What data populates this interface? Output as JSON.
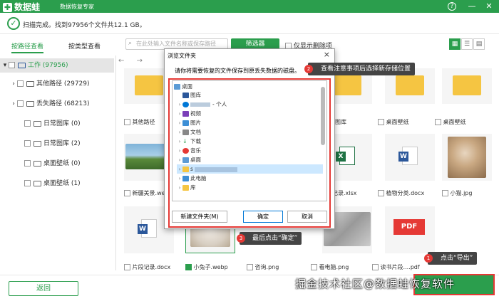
{
  "app": {
    "name": "数据蛙",
    "subtitle": "数据恢复专家",
    "status": "扫描完成。找到97956个文件共12.1 GB。"
  },
  "colors": {
    "brand": "#2b9e4d",
    "accent_red": "#e53935"
  },
  "sidebar": {
    "tabs": [
      "按路径查看",
      "按类型查看"
    ],
    "tree": [
      {
        "label": "工作 (97956)"
      },
      {
        "label": "其他路径 (29729)"
      },
      {
        "label": "丢失路径 (68213)"
      },
      {
        "label": "日常图库 (0)"
      },
      {
        "label": "日常图库 (2)"
      },
      {
        "label": "桌面壁纸 (0)"
      },
      {
        "label": "桌面壁纸 (1)"
      }
    ]
  },
  "toolbar": {
    "search_placeholder": "在此处输入文件名称或保存路径",
    "filter_label": "筛选器",
    "only_deleted_label": "仅显示删除项"
  },
  "grid": {
    "labels": [
      "其他路径",
      "桌面图库",
      "桌面壁纸",
      "桌面壁纸",
      "新疆美景.webp",
      "记录.xlsx",
      "植物分类.docx",
      "小猫.jpg",
      "片段记录.docx",
      "小兔子.webp",
      "咨询.png",
      "看电脑.png",
      "读书片段....pdf"
    ],
    "pdf_label": "PDF"
  },
  "dialog": {
    "title": "浏览文件夹",
    "close": "×",
    "instruction": "请你将需要恢复的文件保存到原丢失数据的磁盘。",
    "tree": [
      {
        "label": "桌面"
      },
      {
        "label": "图库"
      },
      {
        "label": "- 个人"
      },
      {
        "label": "视频"
      },
      {
        "label": "图片"
      },
      {
        "label": "文档"
      },
      {
        "label": "下载"
      },
      {
        "label": "音乐"
      },
      {
        "label": "桌面"
      },
      {
        "label": "s"
      },
      {
        "label": "此电脑"
      },
      {
        "label": "库"
      }
    ],
    "new_folder": "新建文件夹(M)",
    "ok": "确定",
    "cancel": "取消"
  },
  "callouts": [
    {
      "num": "2",
      "text": "查看注意事项后选择新存储位置"
    },
    {
      "num": "3",
      "text": "最后点击“确定”"
    },
    {
      "num": "1",
      "text": "点击“导出”"
    }
  ],
  "footer": {
    "back_label": "返回",
    "watermark": "掘金技术社区@数据蛙恢复软件"
  }
}
